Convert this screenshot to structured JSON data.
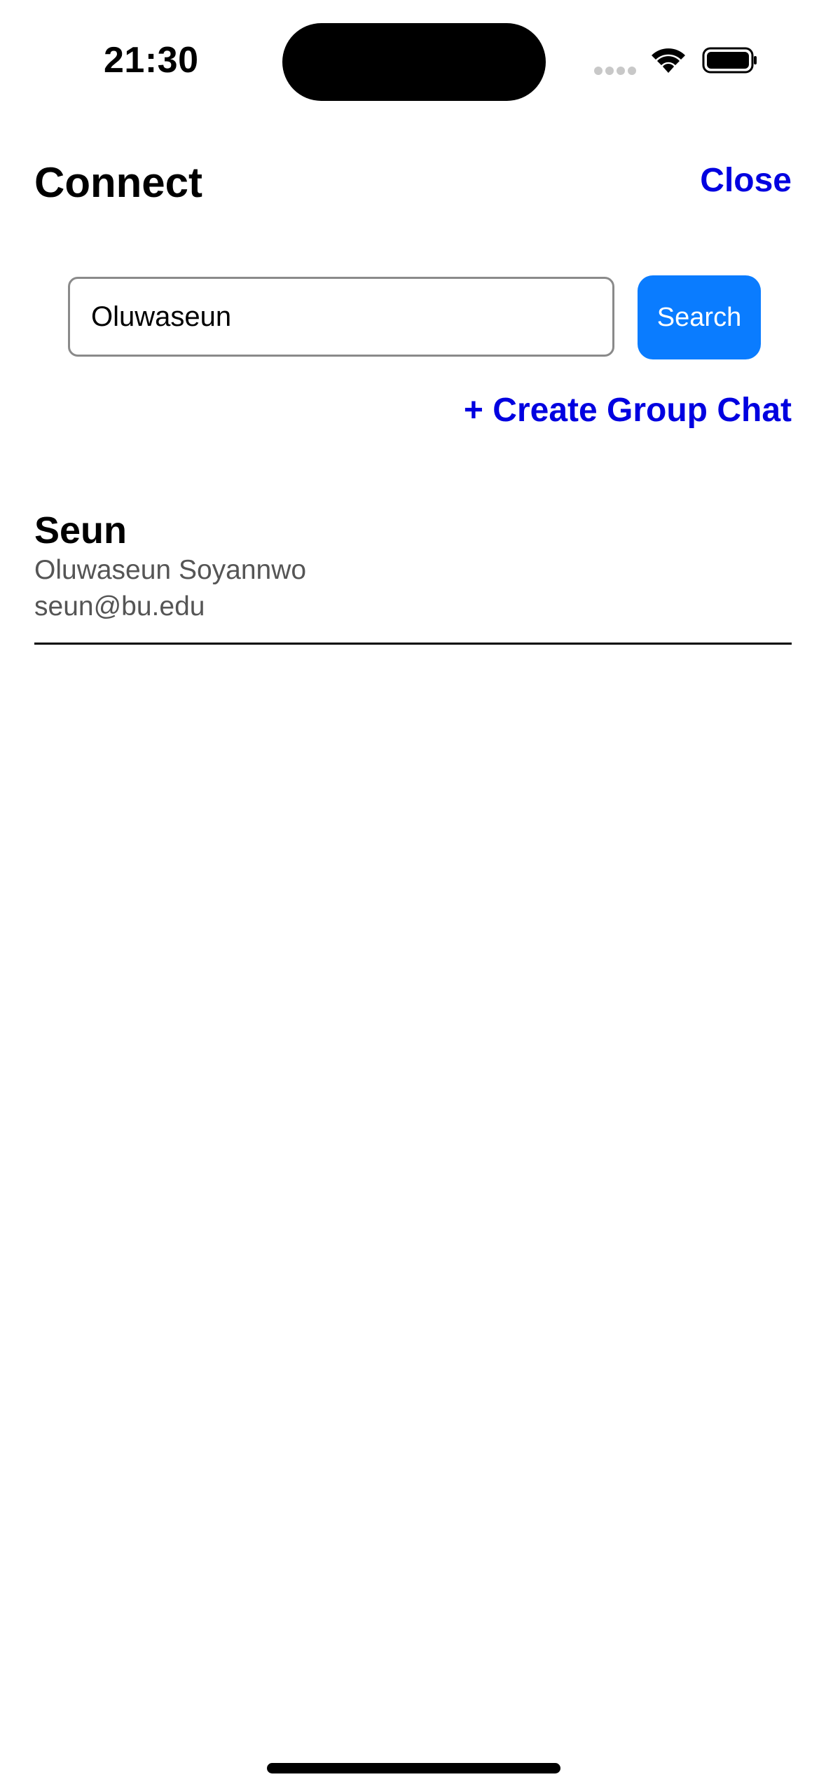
{
  "status_bar": {
    "time": "21:30",
    "icons": [
      "signal-icon",
      "wifi-icon",
      "battery-icon"
    ]
  },
  "header": {
    "title": "Connect",
    "close_label": "Close"
  },
  "search": {
    "value": "Oluwaseun",
    "button_label": "Search"
  },
  "actions": {
    "create_group_label": "+ Create Group Chat"
  },
  "results": [
    {
      "username": "Seun",
      "full_name": "Oluwaseun Soyannwo",
      "email": "seun@bu.edu"
    }
  ],
  "colors": {
    "link": "#0000e0",
    "primary_button": "#0a7cff",
    "secondary_text": "#555555"
  }
}
